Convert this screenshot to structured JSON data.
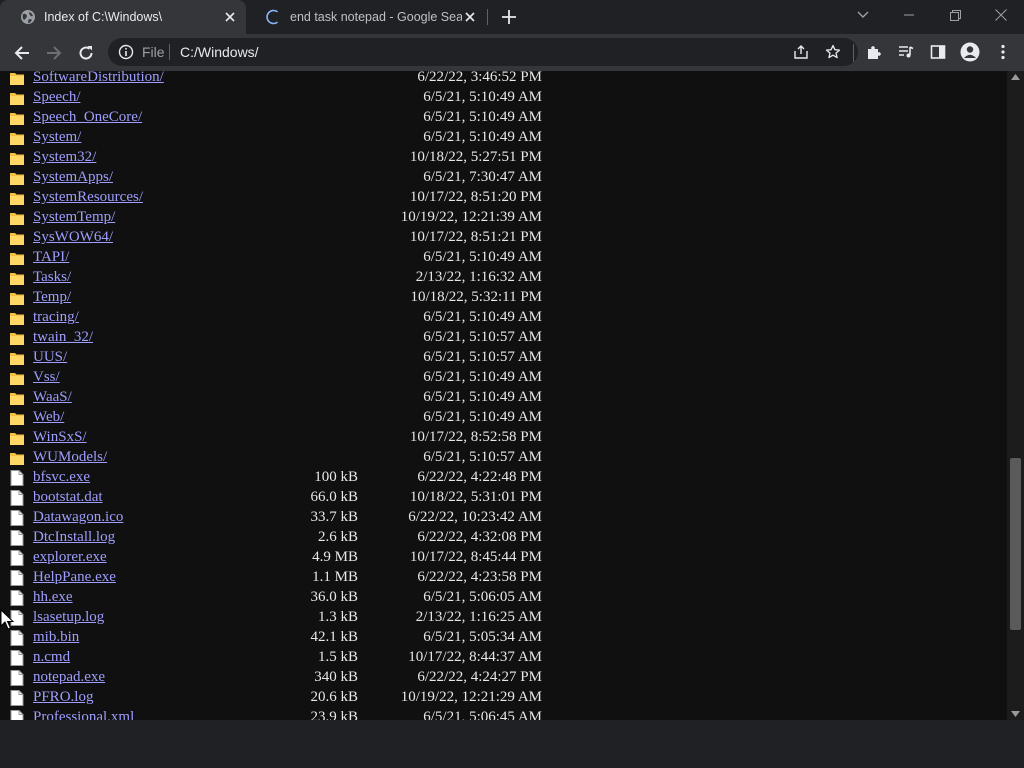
{
  "tabs": [
    {
      "title": "Index of C:\\Windows\\",
      "active": true
    },
    {
      "title": "end task notepad - Google Search",
      "active": false
    }
  ],
  "toolbar": {
    "scheme_label": "File",
    "url": "C:/Windows/"
  },
  "colors": {
    "link": "#9e9efe",
    "text": "#e8e8e8",
    "page_bg": "#101010",
    "chrome_bg": "#35363a",
    "folder": "#f6c244"
  },
  "listing": [
    {
      "name": "SoftwareDistribution/",
      "size": "",
      "date": "6/22/22, 3:46:52 PM",
      "type": "folder"
    },
    {
      "name": "Speech/",
      "size": "",
      "date": "6/5/21, 5:10:49 AM",
      "type": "folder"
    },
    {
      "name": "Speech_OneCore/",
      "size": "",
      "date": "6/5/21, 5:10:49 AM",
      "type": "folder"
    },
    {
      "name": "System/",
      "size": "",
      "date": "6/5/21, 5:10:49 AM",
      "type": "folder"
    },
    {
      "name": "System32/",
      "size": "",
      "date": "10/18/22, 5:27:51 PM",
      "type": "folder"
    },
    {
      "name": "SystemApps/",
      "size": "",
      "date": "6/5/21, 7:30:47 AM",
      "type": "folder"
    },
    {
      "name": "SystemResources/",
      "size": "",
      "date": "10/17/22, 8:51:20 PM",
      "type": "folder"
    },
    {
      "name": "SystemTemp/",
      "size": "",
      "date": "10/19/22, 12:21:39 AM",
      "type": "folder"
    },
    {
      "name": "SysWOW64/",
      "size": "",
      "date": "10/17/22, 8:51:21 PM",
      "type": "folder"
    },
    {
      "name": "TAPI/",
      "size": "",
      "date": "6/5/21, 5:10:49 AM",
      "type": "folder"
    },
    {
      "name": "Tasks/",
      "size": "",
      "date": "2/13/22, 1:16:32 AM",
      "type": "folder"
    },
    {
      "name": "Temp/",
      "size": "",
      "date": "10/18/22, 5:32:11 PM",
      "type": "folder"
    },
    {
      "name": "tracing/",
      "size": "",
      "date": "6/5/21, 5:10:49 AM",
      "type": "folder"
    },
    {
      "name": "twain_32/",
      "size": "",
      "date": "6/5/21, 5:10:57 AM",
      "type": "folder"
    },
    {
      "name": "UUS/",
      "size": "",
      "date": "6/5/21, 5:10:57 AM",
      "type": "folder"
    },
    {
      "name": "Vss/",
      "size": "",
      "date": "6/5/21, 5:10:49 AM",
      "type": "folder"
    },
    {
      "name": "WaaS/",
      "size": "",
      "date": "6/5/21, 5:10:49 AM",
      "type": "folder"
    },
    {
      "name": "Web/",
      "size": "",
      "date": "6/5/21, 5:10:49 AM",
      "type": "folder"
    },
    {
      "name": "WinSxS/",
      "size": "",
      "date": "10/17/22, 8:52:58 PM",
      "type": "folder"
    },
    {
      "name": "WUModels/",
      "size": "",
      "date": "6/5/21, 5:10:57 AM",
      "type": "folder"
    },
    {
      "name": "bfsvc.exe",
      "size": "100 kB",
      "date": "6/22/22, 4:22:48 PM",
      "type": "file"
    },
    {
      "name": "bootstat.dat",
      "size": "66.0 kB",
      "date": "10/18/22, 5:31:01 PM",
      "type": "file"
    },
    {
      "name": "Datawagon.ico",
      "size": "33.7 kB",
      "date": "6/22/22, 10:23:42 AM",
      "type": "file"
    },
    {
      "name": "DtcInstall.log",
      "size": "2.6 kB",
      "date": "6/22/22, 4:32:08 PM",
      "type": "file"
    },
    {
      "name": "explorer.exe",
      "size": "4.9 MB",
      "date": "10/17/22, 8:45:44 PM",
      "type": "file"
    },
    {
      "name": "HelpPane.exe",
      "size": "1.1 MB",
      "date": "6/22/22, 4:23:58 PM",
      "type": "file"
    },
    {
      "name": "hh.exe",
      "size": "36.0 kB",
      "date": "6/5/21, 5:06:05 AM",
      "type": "file"
    },
    {
      "name": "lsasetup.log",
      "size": "1.3 kB",
      "date": "2/13/22, 1:16:25 AM",
      "type": "file"
    },
    {
      "name": "mib.bin",
      "size": "42.1 kB",
      "date": "6/5/21, 5:05:34 AM",
      "type": "file"
    },
    {
      "name": "n.cmd",
      "size": "1.5 kB",
      "date": "10/17/22, 8:44:37 AM",
      "type": "file"
    },
    {
      "name": "notepad.exe",
      "size": "340 kB",
      "date": "6/22/22, 4:24:27 PM",
      "type": "file"
    },
    {
      "name": "PFRO.log",
      "size": "20.6 kB",
      "date": "10/19/22, 12:21:29 AM",
      "type": "file"
    },
    {
      "name": "Professional.xml",
      "size": "23.9 kB",
      "date": "6/5/21, 5:06:45 AM",
      "type": "file"
    }
  ]
}
